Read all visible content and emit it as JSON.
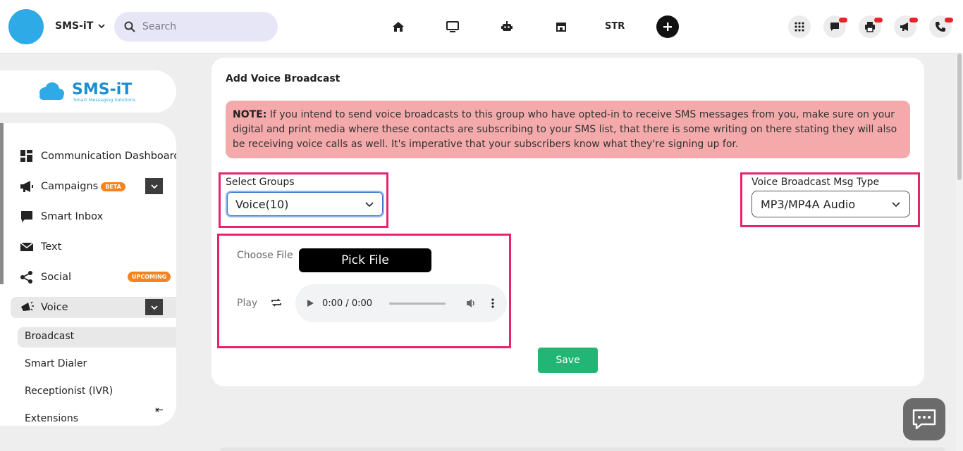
{
  "header": {
    "brand": "SMS-iT",
    "search_placeholder": "Search",
    "nav_str": "STR"
  },
  "logo": {
    "name": "SMS-iT",
    "tagline": "Smart Messaging Solutions"
  },
  "sidebar": {
    "items": [
      {
        "label": "Communication Dashboard"
      },
      {
        "label": "Campaigns",
        "badge": "BETA"
      },
      {
        "label": "Smart Inbox"
      },
      {
        "label": "Text"
      },
      {
        "label": "Social",
        "badge": "UPCOMING"
      },
      {
        "label": "Voice"
      }
    ],
    "voice_sub": [
      {
        "label": "Broadcast"
      },
      {
        "label": "Smart Dialer"
      },
      {
        "label": "Receptionist (IVR)"
      },
      {
        "label": "Extensions"
      }
    ]
  },
  "main": {
    "title": "Add Voice Broadcast",
    "note_bold": "NOTE:",
    "note_text": " If you intend to send voice broadcasts to this group who have opted-in to receive SMS messages from you, make sure on your digital and print media where these contacts are subscribing to your SMS list, that there is some writing on there stating they will also be receiving voice calls as well. It's imperative that your subscribers know what they're signing up for.",
    "select_groups_label": "Select Groups",
    "select_groups_value": "Voice(10)",
    "msg_type_label": "Voice Broadcast Msg Type",
    "msg_type_value": "MP3/MP4A Audio",
    "choose_file_label": "Choose File",
    "pick_file_button": "Pick File",
    "play_label": "Play",
    "audio_time": "0:00 / 0:00",
    "save_button": "Save"
  },
  "colors": {
    "accent_highlight": "#e8246e",
    "note_bg": "#f4aaaa",
    "save_bg": "#22b573",
    "badge_orange": "#f5841f",
    "avatar": "#2eaae6"
  }
}
